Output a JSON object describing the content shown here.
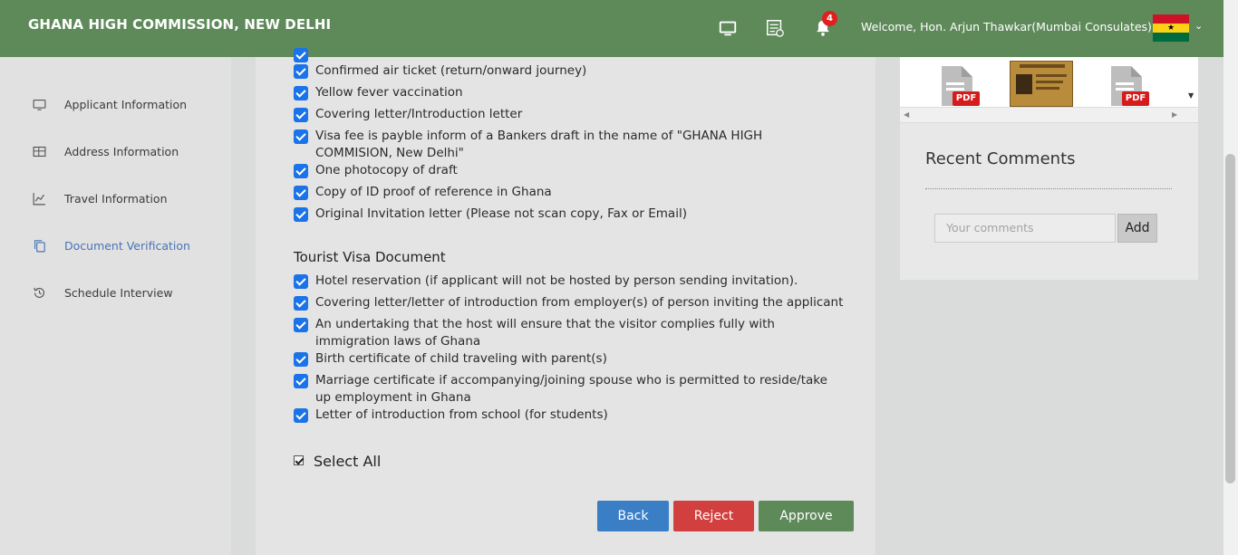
{
  "header": {
    "title": "GHANA HIGH COMMISSION, NEW DELHI",
    "notification_count": "4",
    "welcome": "Welcome, Hon. Arjun Thawkar(Mumbai Consulates)",
    "icons": [
      "monitor-icon",
      "file-list-icon",
      "bell-icon",
      "ghana-flag-icon",
      "chevron-down-icon"
    ]
  },
  "sidebar": {
    "items": [
      {
        "label": "Applicant Information",
        "icon": "monitor-icon",
        "active": false
      },
      {
        "label": "Address Information",
        "icon": "table-icon",
        "active": false
      },
      {
        "label": "Travel Information",
        "icon": "line-chart-icon",
        "active": false
      },
      {
        "label": "Document Verification",
        "icon": "copy-icon",
        "active": true
      },
      {
        "label": "Schedule Interview",
        "icon": "history-icon",
        "active": false
      }
    ]
  },
  "business_docs": [
    "Confirmed air ticket (return/onward journey)",
    "Yellow fever vaccination",
    "Covering letter/Introduction letter",
    "Visa fee is payble inform of a Bankers draft in the name of \"GHANA HIGH COMMISION, New Delhi\"",
    "One photocopy of draft",
    "Copy of ID proof of reference in Ghana",
    "Original Invitation letter (Please not scan copy, Fax or Email)"
  ],
  "tourist": {
    "title": "Tourist Visa Document",
    "items": [
      "Hotel reservation (if applicant will not be hosted by person sending invitation).",
      "Covering letter/letter of introduction from employer(s) of person inviting the applicant",
      "An undertaking that the host will ensure that the visitor complies fully with immigration laws of Ghana",
      "Birth certificate of child traveling with parent(s)",
      "Marriage certificate if accompanying/joining spouse who is permitted to reside/take up employment in Ghana",
      "Letter of introduction from school (for students)"
    ]
  },
  "select_all": "Select All",
  "buttons": {
    "back": "Back",
    "reject": "Reject",
    "approve": "Approve"
  },
  "colors": {
    "header": "#5e8a5a",
    "back": "#3a7fc6",
    "reject": "#d23f3f",
    "approve": "#5e8a5a",
    "checkbox": "#1a73e8",
    "active_nav": "#4a73b6"
  },
  "documents": {
    "pdf_label": "PDF"
  },
  "comments": {
    "title": "Recent Comments",
    "placeholder": "Your comments",
    "add": "Add"
  }
}
